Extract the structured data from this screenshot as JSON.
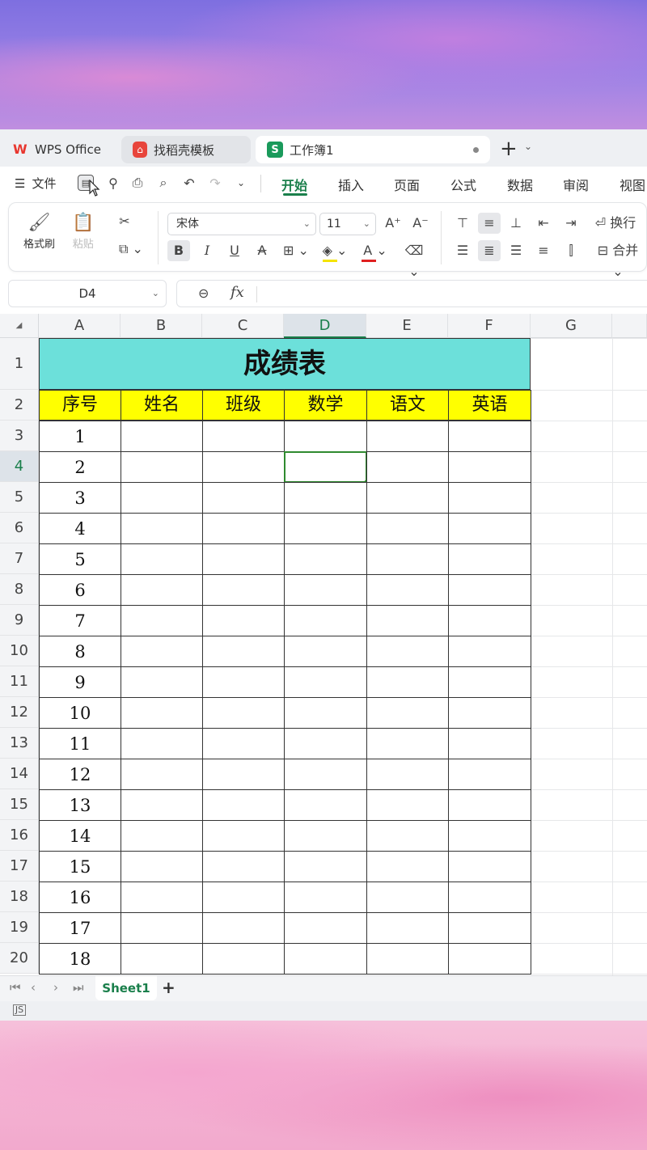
{
  "tabs": {
    "wps_label": "WPS Office",
    "daoke_label": "找稻壳模板",
    "workbook_label": "工作簿1",
    "wps_logo": "W",
    "daoke_logo": "⌂",
    "workbook_logo": "S"
  },
  "menu": {
    "file_label": "文件",
    "tabs": [
      "开始",
      "插入",
      "页面",
      "公式",
      "数据",
      "审阅",
      "视图"
    ],
    "active_tab": "开始"
  },
  "ribbon": {
    "format_painter": "格式刷",
    "paste": "粘贴",
    "font_name": "宋体",
    "font_size": "11",
    "bold": "B",
    "italic": "I",
    "underline": "U",
    "strike": "A",
    "wrap": "换行",
    "merge": "合并",
    "grow": "A⁺",
    "shrink": "A⁻"
  },
  "formula": {
    "name_box": "D4",
    "fx": "fx",
    "value": ""
  },
  "columns": [
    "A",
    "B",
    "C",
    "D",
    "E",
    "F",
    "G"
  ],
  "active_column": "D",
  "rows": [
    "1",
    "2",
    "3",
    "4",
    "5",
    "6",
    "7",
    "8",
    "9",
    "10",
    "11",
    "12",
    "13",
    "14",
    "15",
    "16",
    "17",
    "18",
    "19",
    "20"
  ],
  "active_row": "4",
  "sheet": {
    "title": "成绩表",
    "headers": [
      "序号",
      "姓名",
      "班级",
      "数学",
      "语文",
      "英语"
    ],
    "serials": [
      "1",
      "2",
      "3",
      "4",
      "5",
      "6",
      "7",
      "8",
      "9",
      "10",
      "11",
      "12",
      "13",
      "14",
      "15",
      "16",
      "17",
      "18"
    ],
    "selected_cell": "D4"
  },
  "sheet_tabs": {
    "active": "Sheet1",
    "add": "+"
  },
  "colors": {
    "title_fill": "#6ce0da",
    "header_fill": "#ffff00",
    "accent": "#1a7f4b"
  }
}
